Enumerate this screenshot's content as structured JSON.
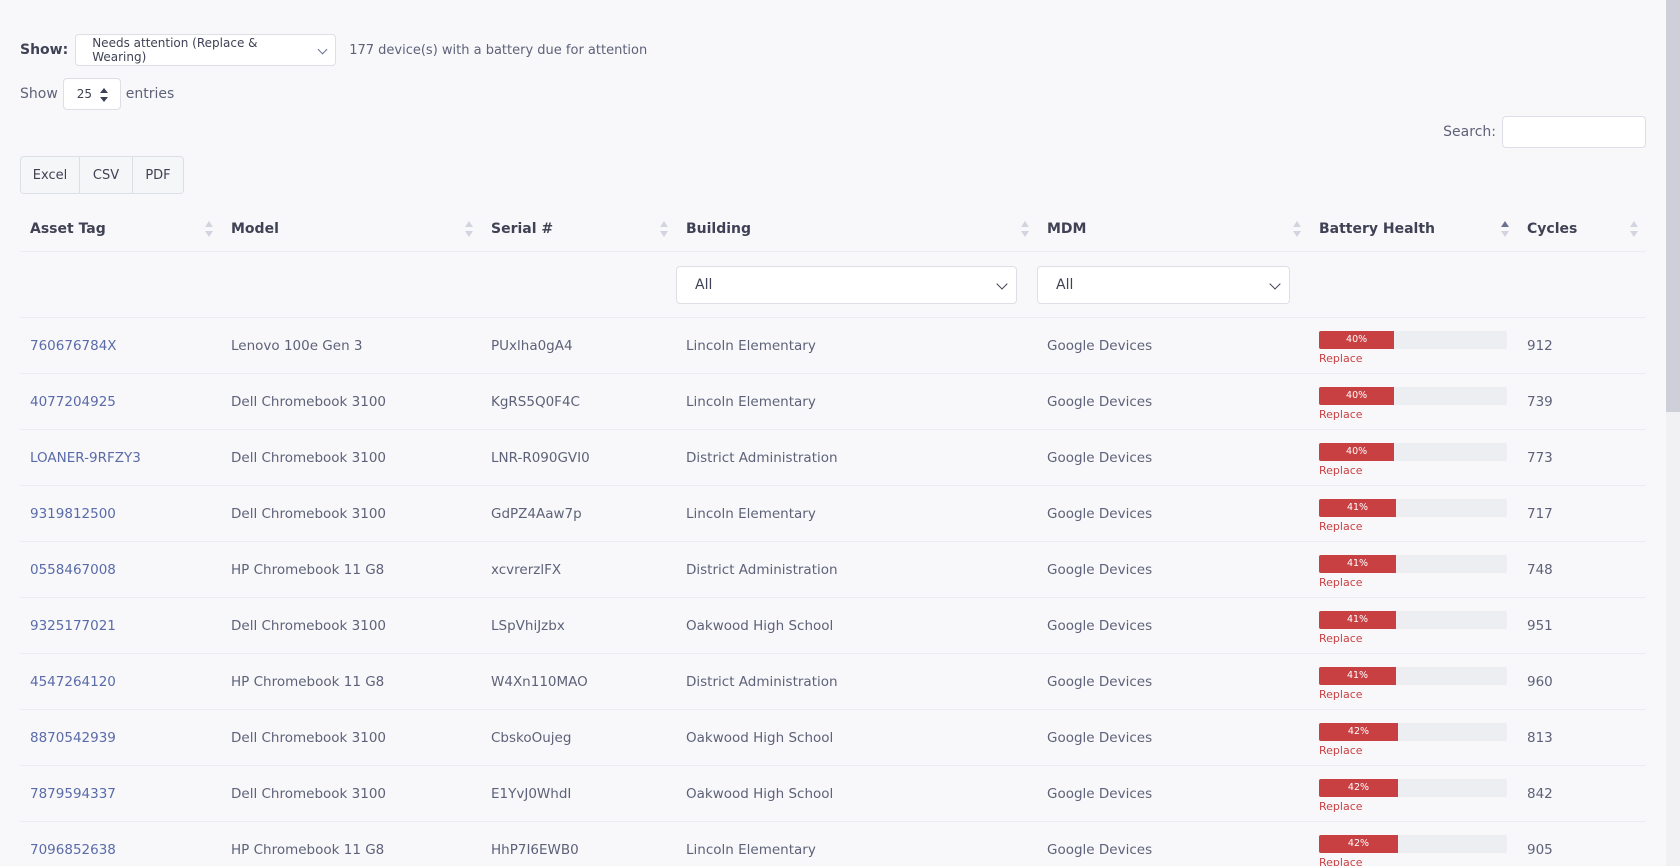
{
  "filter": {
    "label": "Show:",
    "selected": "Needs attention (Replace & Wearing)",
    "note": "177 device(s) with a battery due for attention"
  },
  "entries": {
    "prefix": "Show",
    "value": "25",
    "suffix": "entries"
  },
  "search": {
    "label": "Search:",
    "value": ""
  },
  "export_buttons": [
    "Excel",
    "CSV",
    "PDF"
  ],
  "table": {
    "columns": [
      "Asset Tag",
      "Model",
      "Serial #",
      "Building",
      "MDM",
      "Battery Health",
      "Cycles"
    ],
    "sorted_column": "Battery Health",
    "building_filter": "All",
    "mdm_filter": "All",
    "rows": [
      {
        "asset_tag": "760676784X",
        "model": "Lenovo 100e Gen 3",
        "serial": "PUxlha0gA4",
        "building": "Lincoln Elementary",
        "mdm": "Google Devices",
        "battery_label": "40%",
        "battery_value": 40,
        "status": "Replace",
        "cycles": "912"
      },
      {
        "asset_tag": "4077204925",
        "model": "Dell Chromebook 3100",
        "serial": "KgRS5Q0F4C",
        "building": "Lincoln Elementary",
        "mdm": "Google Devices",
        "battery_label": "40%",
        "battery_value": 40,
        "status": "Replace",
        "cycles": "739"
      },
      {
        "asset_tag": "LOANER-9RFZY3",
        "model": "Dell Chromebook 3100",
        "serial": "LNR-R090GVI0",
        "building": "District Administration",
        "mdm": "Google Devices",
        "battery_label": "40%",
        "battery_value": 40,
        "status": "Replace",
        "cycles": "773"
      },
      {
        "asset_tag": "9319812500",
        "model": "Dell Chromebook 3100",
        "serial": "GdPZ4Aaw7p",
        "building": "Lincoln Elementary",
        "mdm": "Google Devices",
        "battery_label": "41%",
        "battery_value": 41,
        "status": "Replace",
        "cycles": "717"
      },
      {
        "asset_tag": "0558467008",
        "model": "HP Chromebook 11 G8",
        "serial": "xcvrerzlFX",
        "building": "District Administration",
        "mdm": "Google Devices",
        "battery_label": "41%",
        "battery_value": 41,
        "status": "Replace",
        "cycles": "748"
      },
      {
        "asset_tag": "9325177021",
        "model": "Dell Chromebook 3100",
        "serial": "LSpVhiJzbx",
        "building": "Oakwood High School",
        "mdm": "Google Devices",
        "battery_label": "41%",
        "battery_value": 41,
        "status": "Replace",
        "cycles": "951"
      },
      {
        "asset_tag": "4547264120",
        "model": "HP Chromebook 11 G8",
        "serial": "W4Xn110MAO",
        "building": "District Administration",
        "mdm": "Google Devices",
        "battery_label": "41%",
        "battery_value": 41,
        "status": "Replace",
        "cycles": "960"
      },
      {
        "asset_tag": "8870542939",
        "model": "Dell Chromebook 3100",
        "serial": "CbskoOujeg",
        "building": "Oakwood High School",
        "mdm": "Google Devices",
        "battery_label": "42%",
        "battery_value": 42,
        "status": "Replace",
        "cycles": "813"
      },
      {
        "asset_tag": "7879594337",
        "model": "Dell Chromebook 3100",
        "serial": "E1YvJ0WhdI",
        "building": "Oakwood High School",
        "mdm": "Google Devices",
        "battery_label": "42%",
        "battery_value": 42,
        "status": "Replace",
        "cycles": "842"
      },
      {
        "asset_tag": "7096852638",
        "model": "HP Chromebook 11 G8",
        "serial": "HhP7I6EWB0",
        "building": "Lincoln Elementary",
        "mdm": "Google Devices",
        "battery_label": "42%",
        "battery_value": 42,
        "status": "Replace",
        "cycles": "905"
      }
    ]
  },
  "colors": {
    "accent_link": "#5a6ba8",
    "battery_replace": "#c94042",
    "battery_track": "#edeef2"
  }
}
